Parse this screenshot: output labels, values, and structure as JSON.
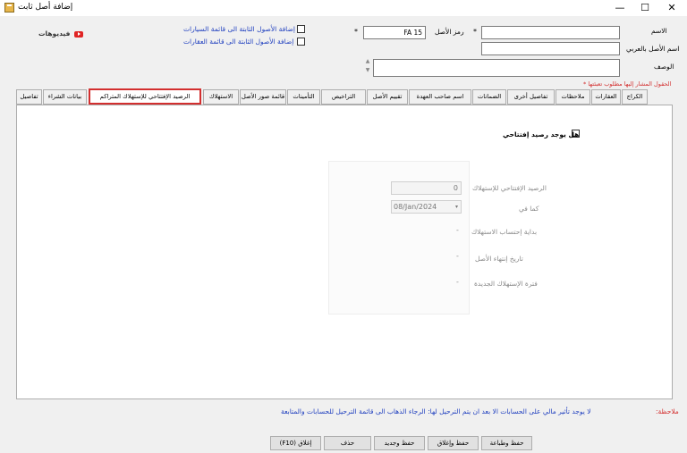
{
  "window": {
    "title": "إضافة أصل ثابت",
    "minimize": "—",
    "maximize": "☐",
    "close": "✕"
  },
  "header": {
    "name_label": "الاسم",
    "name_value": "",
    "arabic_name_label": "اسم الأصل بالعربي",
    "arabic_name_value": "",
    "description_label": "الوصف",
    "description_value": "",
    "asset_code_label": "رمز الأصل",
    "asset_code_value": "FA 15",
    "star": "*",
    "add_to_cars_label": "إضافة الأصول الثابتة الى قائمة السيارات",
    "add_to_realestate_label": "إضافة الأصول الثابتة الى قائمة العقارات",
    "videos_label": "فيديوهات",
    "required_note": "الحقول المشار إليها مطلوب تعبئتها *"
  },
  "tabs": [
    {
      "label": "الكراج"
    },
    {
      "label": "العقارات"
    },
    {
      "label": "ملاحظات"
    },
    {
      "label": "تفاصيل أخرى"
    },
    {
      "label": "الضمانات"
    },
    {
      "label": "اسم صاحب العهدة"
    },
    {
      "label": "تقييم الأصل"
    },
    {
      "label": "التراخيص"
    },
    {
      "label": "التأمينات"
    },
    {
      "label": "قائمة صور الأصل"
    },
    {
      "label": "الاستهلاك"
    },
    {
      "label": "الرصيد الإفتتاحي للإستهلاك المتراكم"
    },
    {
      "label": "بيانات الشراء"
    },
    {
      "label": "تفاصيل"
    }
  ],
  "panel": {
    "has_opening_balance_label": "هل يوجد رصيد إفتتاحي",
    "opening_balance_label": "الرصيد الإفتتاحي للإستهلاك",
    "opening_balance_value": "0",
    "as_of_label": "كما في",
    "as_of_value": "08/Jan/2024",
    "depreciation_start_label": "بداية إحتساب الاستهلاك",
    "depreciation_start_value": "-",
    "asset_end_date_label": "تاريخ إنتهاء الأصل",
    "asset_end_date_value": "-",
    "new_depreciation_period_label": "فترة الإستهلاك الجديدة",
    "new_depreciation_period_value": "-"
  },
  "footer": {
    "note_label": "ملاحظة:",
    "note_text": "لا يوجد تأثير مالي على الحسابات الا بعد ان يتم الترحيل لها: الرجاء الذهاب الى قائمة الترحيل للحسابات والمتابعة",
    "save_print": "حفظ وطباعة",
    "save_close": "حفظ وإغلاق",
    "save_new": "حفظ وجديد",
    "delete": "حذف",
    "close": "إغلاق (F10)"
  },
  "colors": {
    "accent_red": "#d32f2f",
    "note_red": "#d32f2f",
    "note_blue": "#1f3fbf"
  }
}
